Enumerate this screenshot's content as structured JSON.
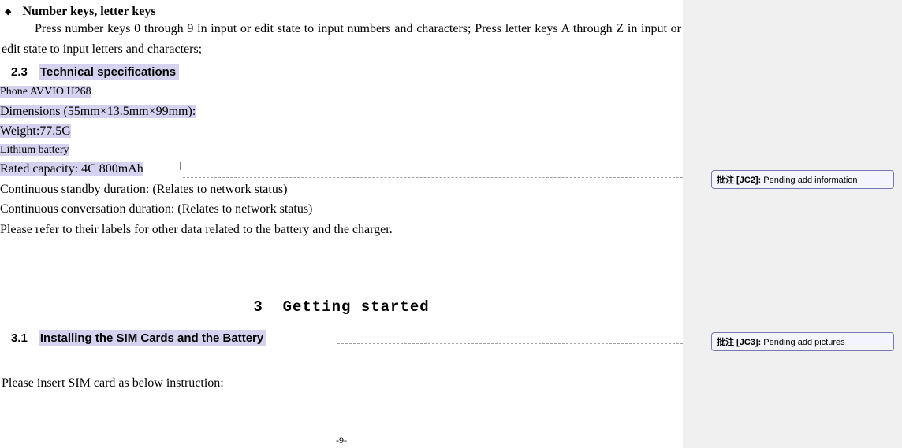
{
  "bullet": {
    "symbol": "◆",
    "title": "Number keys, letter keys"
  },
  "paragraph1": "Press number keys 0 through 9 in input or edit state to input numbers and characters; Press letter keys A through Z in input or edit state to input letters and characters;",
  "section23": {
    "num": "2.3",
    "title": "Technical specifications"
  },
  "specs": {
    "line1": "Phone AVVIO H268",
    "line2": "Dimensions (55mm×13.5mm×99mm):",
    "line3": "Weight:77.5G",
    "line4": "Lithium battery",
    "line5": "Rated capacity: 4C 800mAh",
    "line6": "Continuous standby duration: (Relates to network status)",
    "line7": "Continuous conversation duration: (Relates to network status)",
    "line8": "Please refer to their labels for other data related to the battery and the charger."
  },
  "chapter3": {
    "num": "3",
    "title": "Getting started"
  },
  "section31": {
    "num": "3.1",
    "title": "Installing the SIM Cards and the Battery"
  },
  "paragraph2": "Please insert SIM card as below instruction:",
  "pageNumber": "-9-",
  "comments": {
    "c2": {
      "labelZh": "批注",
      "label": " [JC2]: ",
      "text": "Pending add information"
    },
    "c3": {
      "labelZh": "批注",
      "label": " [JC3]: ",
      "text": "Pending add pictures"
    }
  }
}
